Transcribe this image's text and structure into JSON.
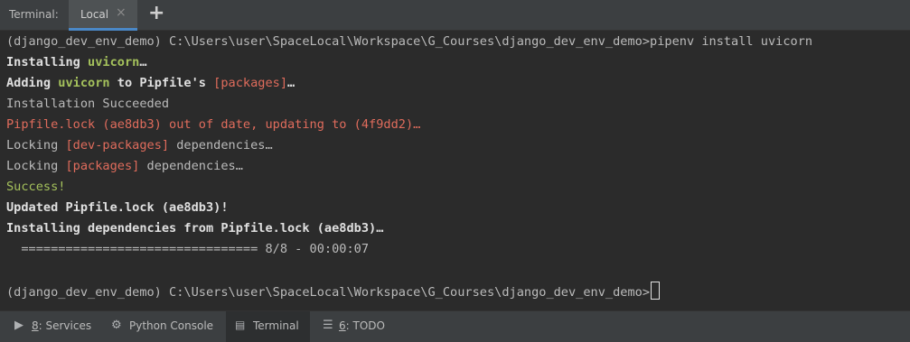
{
  "tabbar": {
    "title": "Terminal:",
    "tab_label": "Local",
    "close_glyph": "×",
    "add_glyph": "+"
  },
  "terminal": {
    "lines": [
      {
        "prompt": "(django_dev_env_demo) C:\\Users\\user\\SpaceLocal\\Workspace\\G_Courses\\django_dev_env_demo>",
        "command": "pipenv install uvicorn"
      },
      {
        "a": "Installing ",
        "b": "uvicorn",
        "c": "…"
      },
      {
        "a": "Adding ",
        "b": "uvicorn",
        "c": " to Pipfile's ",
        "d": "[packages]",
        "e": "…"
      },
      {
        "a": "Installation Succeeded"
      },
      {
        "a": "Pipfile.lock (ae8db3) out of date, updating to (4f9dd2)…"
      },
      {
        "a": "Locking ",
        "b": "[dev-packages]",
        "c": " dependencies…"
      },
      {
        "a": "Locking ",
        "b": "[packages]",
        "c": " dependencies…"
      },
      {
        "a": "Success!"
      },
      {
        "a": "Updated Pipfile.lock (ae8db3)!"
      },
      {
        "a": "Installing dependencies from Pipfile.lock (ae8db3)…"
      },
      {
        "a": "  ================================ 8/8 - 00:00:07"
      },
      {
        "prompt": "(django_dev_env_demo) C:\\Users\\user\\SpaceLocal\\Workspace\\G_Courses\\django_dev_env_demo>"
      }
    ]
  },
  "statusbar": {
    "items": [
      {
        "key": "8",
        "label": ": Services",
        "icon": "services-icon"
      },
      {
        "label": "Python Console",
        "icon": "python-icon"
      },
      {
        "label": "Terminal",
        "icon": "terminal-icon"
      },
      {
        "key": "6",
        "label": ": TODO",
        "icon": "todo-icon"
      }
    ]
  },
  "colors": {
    "accent": "#4a88c7",
    "yellow_green": "#a5c25c",
    "red": "#e06c5c",
    "background": "#2b2b2b"
  }
}
